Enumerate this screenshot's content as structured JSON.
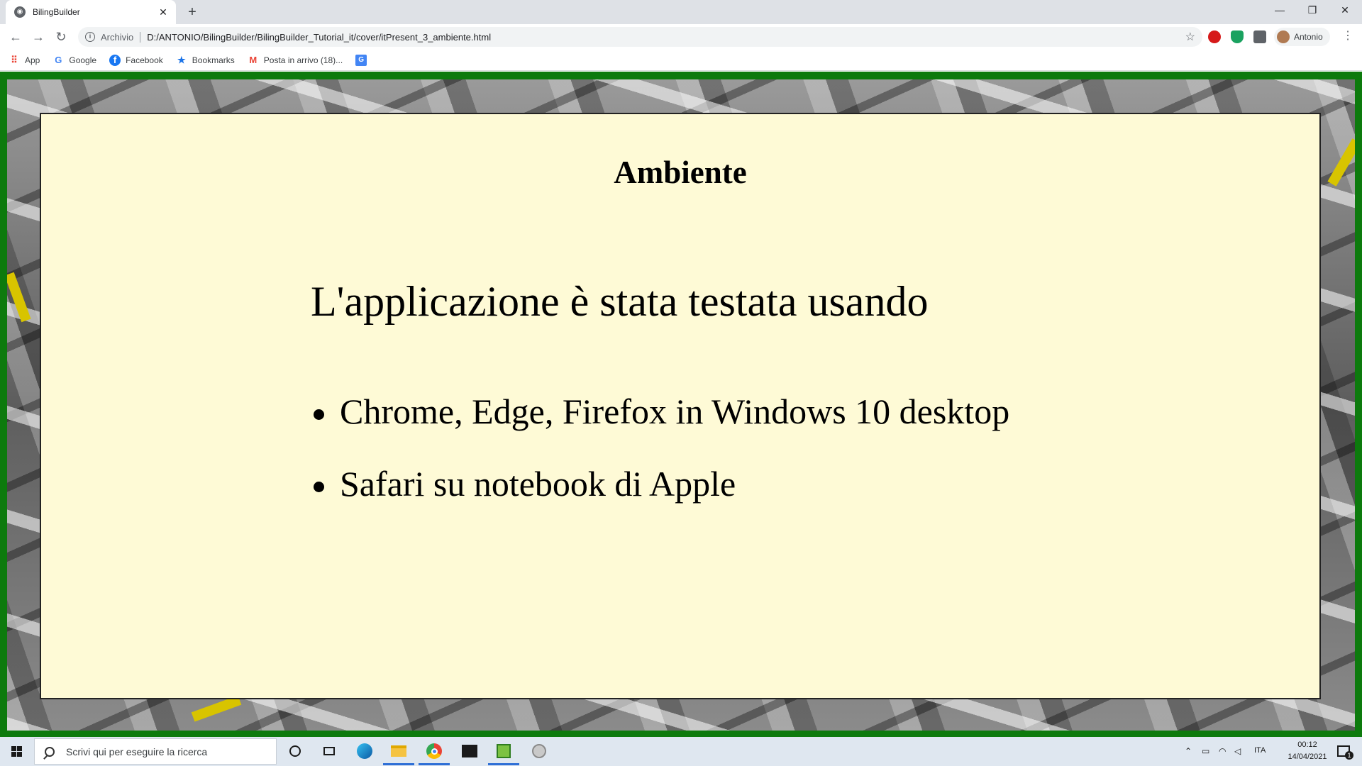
{
  "browser": {
    "tab_title": "BilingBuilder",
    "tab_close": "✕",
    "new_tab": "+",
    "window_controls": {
      "minimize": "—",
      "restore": "❐",
      "close": "✕"
    },
    "nav": {
      "back": "←",
      "forward": "→",
      "reload": "↻"
    },
    "omnibox": {
      "chip": "Archivio",
      "url": "D:/ANTONIO/BilingBuilder/BilingBuilder_Tutorial_it/cover/itPresent_3_ambiente.html"
    },
    "profile_name": "Antonio",
    "bookmarks": [
      {
        "label": "App",
        "icon": "apps-grid-icon"
      },
      {
        "label": "Google",
        "icon": "google-icon"
      },
      {
        "label": "Facebook",
        "icon": "facebook-icon"
      },
      {
        "label": "Bookmarks",
        "icon": "star-icon"
      },
      {
        "label": "Posta in arrivo (18)...",
        "icon": "gmail-icon"
      }
    ]
  },
  "slide": {
    "title": "Ambiente",
    "lead": "L'applicazione è stata testata usando",
    "items": [
      "Chrome, Edge, Firefox in Windows 10 desktop",
      "Safari su notebook di Apple"
    ]
  },
  "taskbar": {
    "search_placeholder": "Scrivi qui per eseguire la ricerca",
    "language": "ITA",
    "time": "00:12",
    "date": "14/04/2021",
    "notification_count": "1"
  },
  "colors": {
    "page_border": "#0d7a0d",
    "slide_background": "#fefad6",
    "taskbar_background": "#dfe7f0"
  }
}
